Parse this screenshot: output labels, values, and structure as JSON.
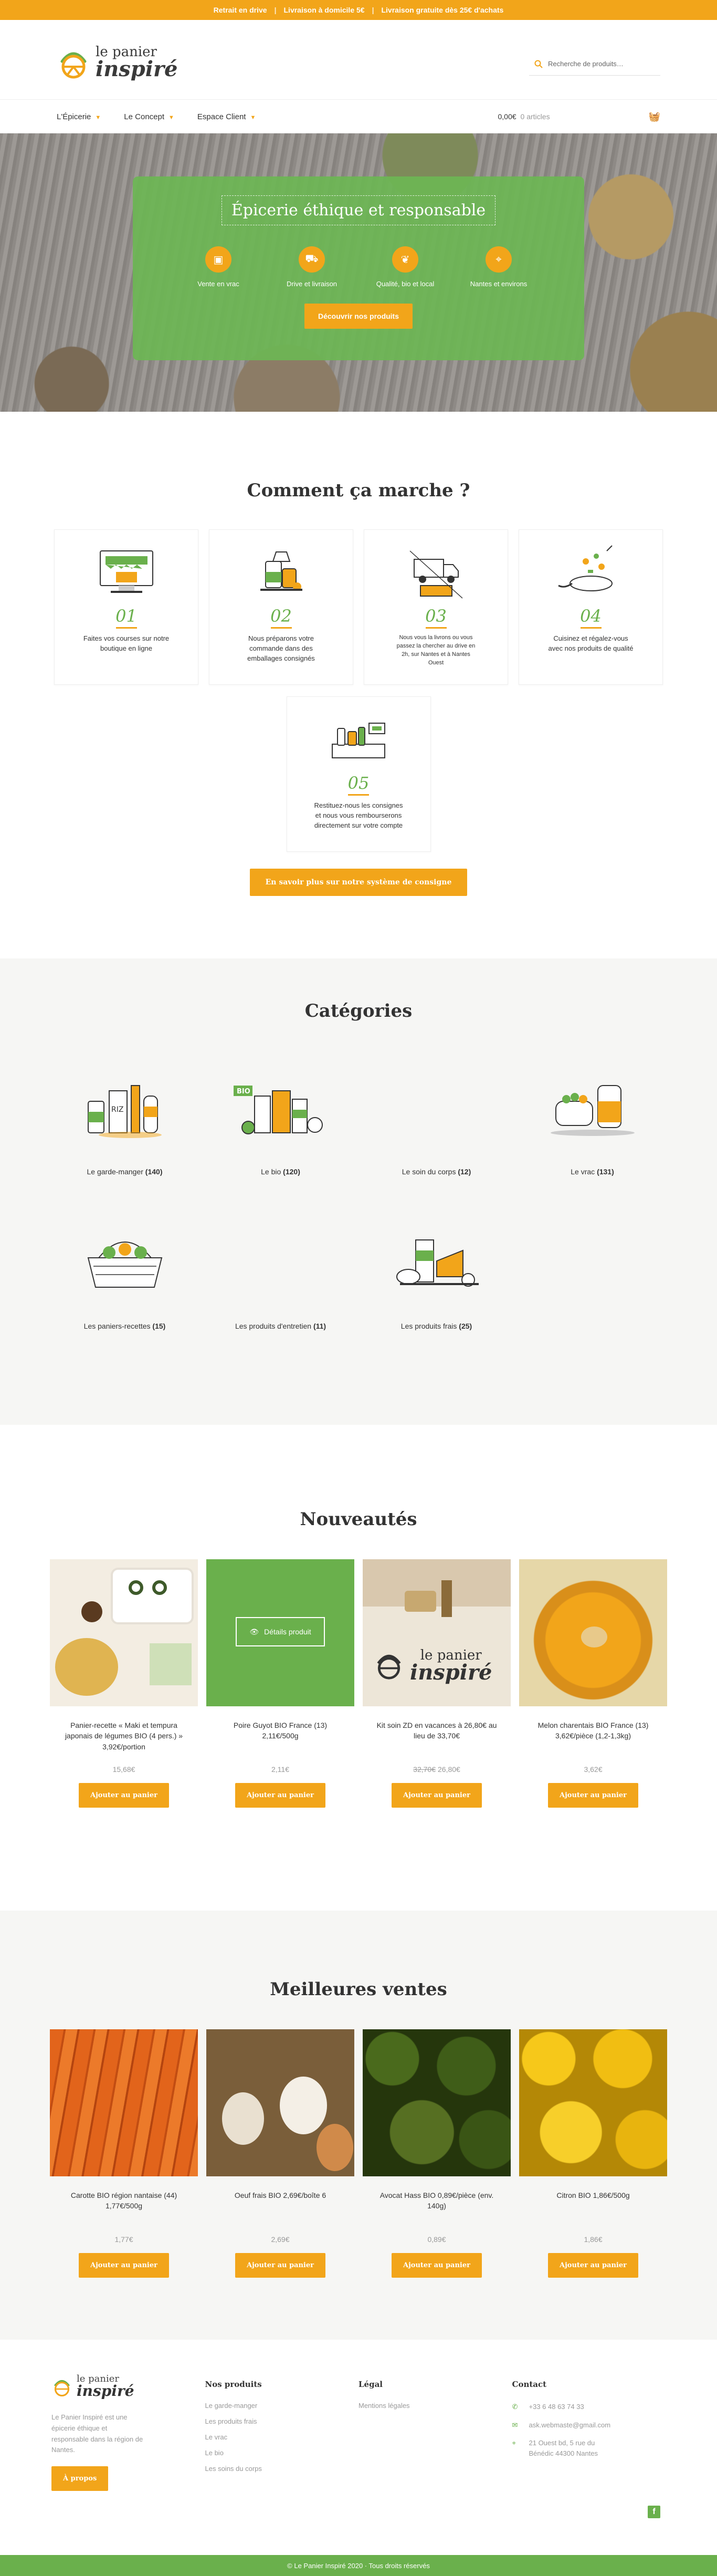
{
  "topbar": {
    "items": [
      "Retrait en drive",
      "Livraison à domicile 5€",
      "Livraison gratuite dès 25€ d'achats"
    ],
    "separator": "|"
  },
  "header": {
    "logo_line1": "le panier",
    "logo_line2": "inspiré",
    "search_placeholder": "Recherche de produits…"
  },
  "nav": {
    "items": [
      {
        "label": "L'Épicerie"
      },
      {
        "label": "Le Concept"
      },
      {
        "label": "Espace Client"
      }
    ],
    "cart_total": "0,00€",
    "cart_count": "0 articles"
  },
  "hero": {
    "title": "Épicerie éthique et responsable",
    "features": [
      {
        "label": "Vente en vrac",
        "icon": "bag-icon"
      },
      {
        "label": "Drive et livraison",
        "icon": "truck-icon"
      },
      {
        "label": "Qualité, bio et local",
        "icon": "leaf-icon"
      },
      {
        "label": "Nantes et environs",
        "icon": "location-pin-icon"
      }
    ],
    "cta": "Découvrir nos produits"
  },
  "how": {
    "title": "Comment ça marche ?",
    "steps": [
      {
        "num": "01",
        "text": "Faites vos courses sur notre boutique en ligne"
      },
      {
        "num": "02",
        "text": "Nous préparons votre commande dans des emballages consignés"
      },
      {
        "num": "03",
        "text": "Nous vous la livrons ou vous passez la chercher au drive en 2h, sur Nantes et à Nantes Ouest"
      },
      {
        "num": "04",
        "text": "Cuisinez et régalez-vous avec nos produits de qualité"
      },
      {
        "num": "05",
        "text": "Restituez-nous les consignes et nous vous rembourserons directement sur votre compte"
      }
    ],
    "cta": "En savoir plus sur notre système de consigne"
  },
  "categories": {
    "title": "Catégories",
    "items": [
      {
        "name": "Le garde-manger",
        "count": "(140)"
      },
      {
        "name": "Le bio",
        "count": "(120)"
      },
      {
        "name": "Le soin du corps",
        "count": "(12)"
      },
      {
        "name": "Le vrac",
        "count": "(131)"
      },
      {
        "name": "Les paniers-recettes",
        "count": "(15)"
      },
      {
        "name": "Les produits d'entretien",
        "count": "(11)"
      },
      {
        "name": "Les produits frais",
        "count": "(25)"
      }
    ]
  },
  "new_products": {
    "title": "Nouveautés",
    "detail_label": "Détails produit",
    "items": [
      {
        "name": "Panier-recette « Maki et tempura japonais de légumes BIO (4 pers.) » 3,92€/portion",
        "old_price": "",
        "price": "15,68€",
        "button": "Ajouter au panier"
      },
      {
        "name": "Poire Guyot BIO France (13) 2,11€/500g",
        "old_price": "",
        "price": "2,11€",
        "button": "Ajouter au panier"
      },
      {
        "name": "Kit soin ZD en vacances à 26,80€ au lieu de 33,70€",
        "old_price": "32,70€",
        "price": "26,80€",
        "button": "Ajouter au panier"
      },
      {
        "name": "Melon charentais BIO France (13) 3,62€/pièce (1,2-1,3kg)",
        "old_price": "",
        "price": "3,62€",
        "button": "Ajouter au panier"
      }
    ]
  },
  "best_sellers": {
    "title": "Meilleures ventes",
    "items": [
      {
        "name": "Carotte BIO région nantaise (44) 1,77€/500g",
        "price": "1,77€",
        "button": "Ajouter au panier"
      },
      {
        "name": "Oeuf frais BIO 2,69€/boîte 6",
        "price": "2,69€",
        "button": "Ajouter au panier"
      },
      {
        "name": "Avocat Hass BIO 0,89€/pièce (env. 140g)",
        "price": "0,89€",
        "button": "Ajouter au panier"
      },
      {
        "name": "Citron BIO 1,86€/500g",
        "price": "1,86€",
        "button": "Ajouter au panier"
      }
    ]
  },
  "footer": {
    "logo_line1": "le panier",
    "logo_line2": "inspiré",
    "description": "Le Panier Inspiré est une épicerie éthique et responsable dans la région de Nantes.",
    "about_button": "À propos",
    "col_products_title": "Nos produits",
    "col_products": [
      "Le garde-manger",
      "Les produits frais",
      "Le vrac",
      "Le bio",
      "Les soins du corps"
    ],
    "col_legal_title": "Légal",
    "col_legal": [
      "Mentions légales"
    ],
    "col_contact_title": "Contact",
    "phone": "+33 6 48 63 74 33",
    "email": "ask.webmaste@gmail.com",
    "address": "21 Ouest bd, 5 rue du Bénédic 44300 Nantes",
    "copyright": "© Le Panier Inspiré 2020 · Tous droits réservés",
    "facebook": "f"
  }
}
